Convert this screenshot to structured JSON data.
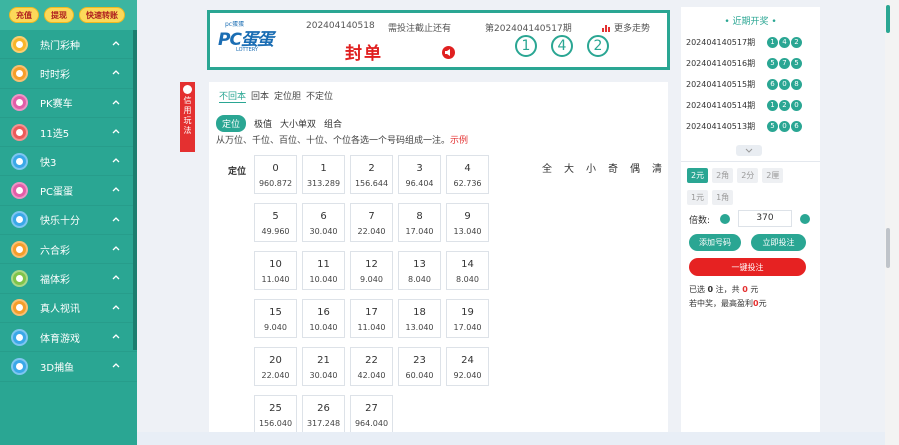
{
  "sidebar": {
    "top_buttons": [
      "充值",
      "提现",
      "快速转账"
    ],
    "items": [
      {
        "label": "热门彩种",
        "color": "#f7b52a"
      },
      {
        "label": "时时彩",
        "color": "#f59e2a"
      },
      {
        "label": "PK赛车",
        "color": "#e35da8"
      },
      {
        "label": "11选5",
        "color": "#ec5a5a"
      },
      {
        "label": "快3",
        "color": "#3aa8e8"
      },
      {
        "label": "PC蛋蛋",
        "color": "#e35da8"
      },
      {
        "label": "快乐十分",
        "color": "#3aa8e8"
      },
      {
        "label": "六合彩",
        "color": "#f59e2a"
      },
      {
        "label": "福体彩",
        "color": "#7fc44a"
      },
      {
        "label": "真人视讯",
        "color": "#f59e2a"
      },
      {
        "label": "体育游戏",
        "color": "#3aa8e8"
      },
      {
        "label": "3D捕鱼",
        "color": "#3aa8e8"
      }
    ]
  },
  "header": {
    "logo_small": "pc蛋蛋",
    "logo_main": "PC蛋蛋",
    "logo_sub": "LOTTERY",
    "issue": "202404140518",
    "deadline": "需投注截止还有",
    "status": "封单",
    "prev_issue": "第202404140517期",
    "balls": [
      "1",
      "4",
      "2"
    ],
    "trend": "更多走势"
  },
  "credit_tag": "信用玩法",
  "main": {
    "tabs": [
      "不回本",
      "回本",
      "定位胆",
      "不定位"
    ],
    "sub_tabs": [
      "定位",
      "极值",
      "大小单双",
      "组合"
    ],
    "desc": "从万位、千位、百位、十位、个位各选一个号码组成一注。",
    "example": "示例",
    "row_label": "定位",
    "shortcuts": [
      "全",
      "大",
      "小",
      "奇",
      "偶",
      "清"
    ],
    "cells": [
      {
        "n": "0",
        "o": "960.872"
      },
      {
        "n": "1",
        "o": "313.289"
      },
      {
        "n": "2",
        "o": "156.644"
      },
      {
        "n": "3",
        "o": "96.404"
      },
      {
        "n": "4",
        "o": "62.736"
      },
      {
        "n": "5",
        "o": "49.960"
      },
      {
        "n": "6",
        "o": "30.040"
      },
      {
        "n": "7",
        "o": "22.040"
      },
      {
        "n": "8",
        "o": "17.040"
      },
      {
        "n": "9",
        "o": "13.040"
      },
      {
        "n": "10",
        "o": "11.040"
      },
      {
        "n": "11",
        "o": "10.040"
      },
      {
        "n": "12",
        "o": "9.040"
      },
      {
        "n": "13",
        "o": "8.040"
      },
      {
        "n": "14",
        "o": "8.040"
      },
      {
        "n": "15",
        "o": "9.040"
      },
      {
        "n": "16",
        "o": "10.040"
      },
      {
        "n": "17",
        "o": "11.040"
      },
      {
        "n": "18",
        "o": "13.040"
      },
      {
        "n": "19",
        "o": "17.040"
      },
      {
        "n": "20",
        "o": "22.040"
      },
      {
        "n": "21",
        "o": "30.040"
      },
      {
        "n": "22",
        "o": "42.040"
      },
      {
        "n": "23",
        "o": "60.040"
      },
      {
        "n": "24",
        "o": "92.040"
      },
      {
        "n": "25",
        "o": "156.040"
      },
      {
        "n": "26",
        "o": "317.248"
      },
      {
        "n": "27",
        "o": "964.040"
      }
    ]
  },
  "right": {
    "recent_title": "• 近期开奖 •",
    "draws": [
      {
        "issue": "202404140517期",
        "balls": [
          "1",
          "4",
          "2"
        ]
      },
      {
        "issue": "202404140516期",
        "balls": [
          "5",
          "7",
          "5"
        ]
      },
      {
        "issue": "202404140515期",
        "balls": [
          "6",
          "0",
          "8"
        ]
      },
      {
        "issue": "202404140514期",
        "balls": [
          "1",
          "2",
          "0"
        ]
      },
      {
        "issue": "202404140513期",
        "balls": [
          "5",
          "0",
          "6"
        ]
      }
    ],
    "units_row1": [
      "2元",
      "2角",
      "2分",
      "2厘"
    ],
    "units_row2": [
      "1元",
      "1角"
    ],
    "multiplier_label": "倍数:",
    "multiplier_value": "370",
    "add_button": "添加号码",
    "bet_button": "立即投注",
    "quick_bet": "一键投注",
    "selected_prefix": "已选",
    "selected_count": "0",
    "selected_mid": "注，共",
    "selected_amount": "0",
    "selected_suffix": "元",
    "profit_prefix": "若中奖，最高盈利",
    "profit_amount": "0",
    "profit_suffix": "元"
  }
}
